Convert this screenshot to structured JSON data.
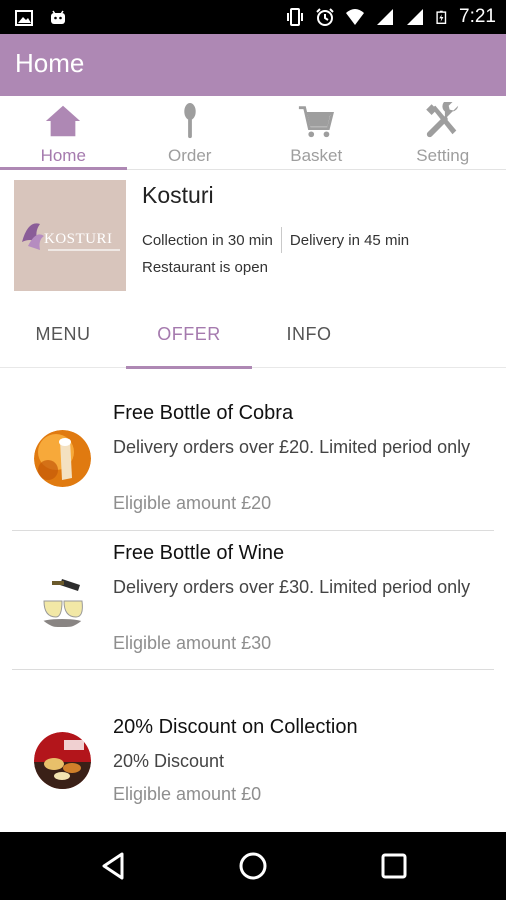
{
  "status_bar": {
    "time": "7:21",
    "left_icons": [
      "image-icon",
      "android-icon"
    ],
    "right_icons": [
      "vibrate-icon",
      "alarm-icon",
      "wifi-icon",
      "signal-icon",
      "signal-icon",
      "battery-icon"
    ]
  },
  "app_bar": {
    "title": "Home"
  },
  "bottom_tabs": [
    {
      "label": "Home",
      "icon": "home-icon",
      "active": true
    },
    {
      "label": "Order",
      "icon": "spoon-icon",
      "active": false
    },
    {
      "label": "Basket",
      "icon": "cart-icon",
      "active": false
    },
    {
      "label": "Setting",
      "icon": "tools-icon",
      "active": false
    }
  ],
  "restaurant": {
    "name": "Kosturi",
    "logo_text": "KOSTURI",
    "collection": "Collection in 30 min",
    "delivery": "Delivery in 45 min",
    "status": "Restaurant is open"
  },
  "sub_tabs": [
    {
      "label": "MENU",
      "active": false
    },
    {
      "label": "OFFER",
      "active": true
    },
    {
      "label": "INFO",
      "active": false
    }
  ],
  "offers": [
    {
      "title": "Free Bottle of Cobra",
      "description": "Delivery orders over £20. Limited period only",
      "eligible": "Eligible amount £20",
      "image": "beer-photo"
    },
    {
      "title": "Free Bottle of Wine",
      "description": "Delivery orders over £30. Limited period only",
      "eligible": "Eligible amount £30",
      "image": "wine-photo"
    },
    {
      "title": "20% Discount on Collection",
      "description": "20% Discount",
      "eligible": "Eligible amount £0",
      "image": "food-photo"
    }
  ],
  "colors": {
    "accent": "#ae88b4",
    "accent_text": "#a57aae",
    "inactive_icon": "#9e9e9e"
  }
}
